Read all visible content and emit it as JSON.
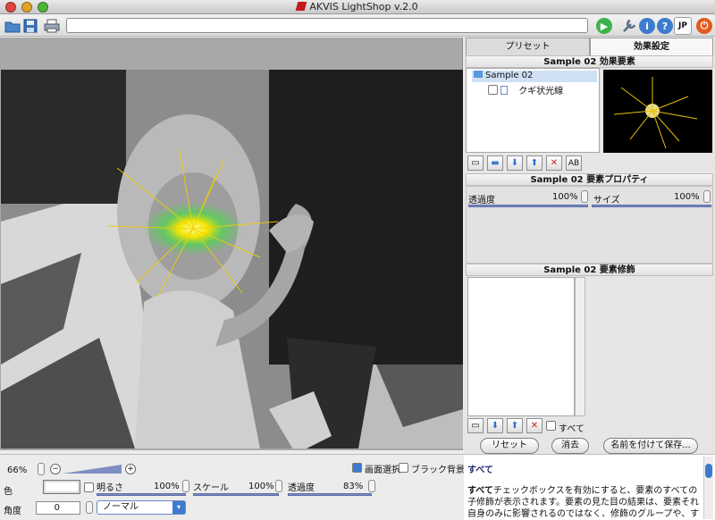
{
  "window": {
    "title": "AKVIS LightShop v.2.0"
  },
  "toolbar": {
    "path_value": "",
    "lang_label": "JP"
  },
  "tabs": [
    {
      "label": "プリセット"
    },
    {
      "label": "効果設定"
    }
  ],
  "elements_panel": {
    "title": "Sample 02 効果要素",
    "tree_root": "Sample 02",
    "tree_child": "クギ状光線"
  },
  "properties_panel": {
    "title": "Sample 02 要素プロパティ",
    "opacity_label": "透過度",
    "opacity_value": "100%",
    "size_label": "サイズ",
    "size_value": "100%"
  },
  "modifiers_panel": {
    "title": "Sample 02 要素修飾",
    "all_label": "すべて"
  },
  "actions": {
    "reset": "リセット",
    "delete": "消去",
    "save_as": "名前を付けて保存..."
  },
  "bottom": {
    "zoom_value": "66%",
    "screen_select_label": "画面選択",
    "black_bg_label": "ブラック背景",
    "color_label": "色",
    "brightness_label": "明るさ",
    "brightness_value": "100%",
    "scale_label": "スケール",
    "scale_value": "100%",
    "opacity_label": "透過度",
    "opacity_value": "83%",
    "angle_label": "角度",
    "angle_value": "0",
    "blend_mode": "ノーマル"
  },
  "help": {
    "heading": "すべて",
    "bold_word": "すべて",
    "body": "チェックボックスを有効にすると、要素のすべての子修飾が表示されます。要素の見た目の結果は、要素それ自身のみに影響されるのではなく、修飾のグループや、す"
  },
  "colors": {
    "accent": "#7e8ec4",
    "help_heading": "#1a2a6c"
  }
}
